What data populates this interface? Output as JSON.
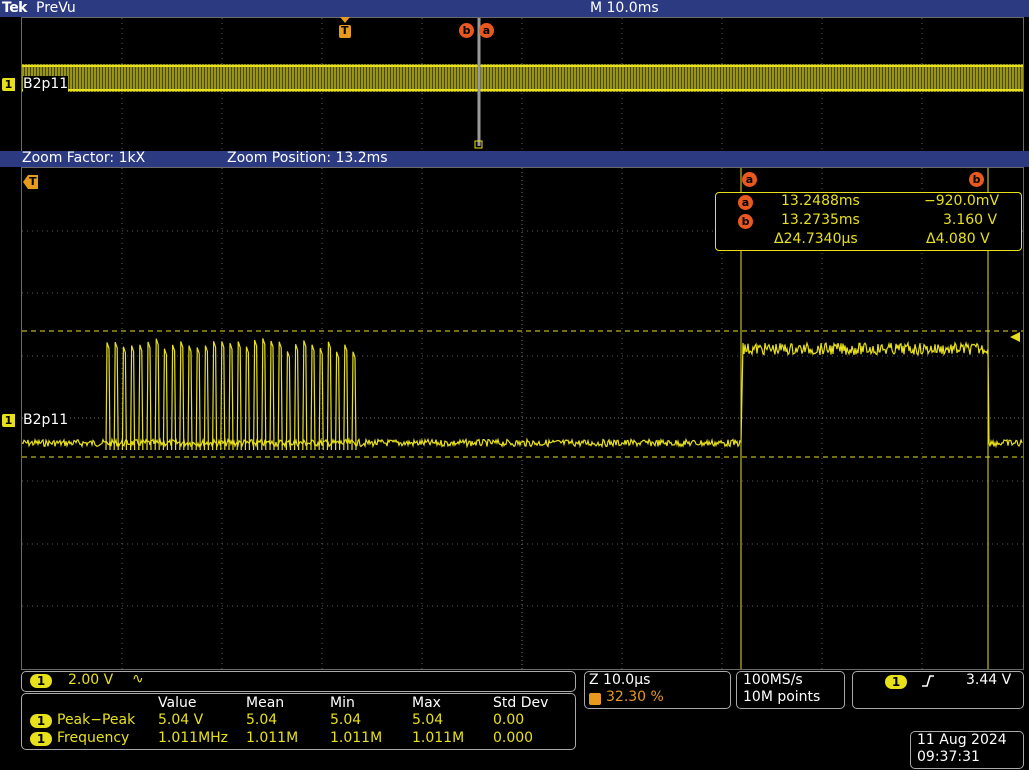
{
  "header": {
    "brand": "Tek",
    "mode": "PreVu",
    "timebase": "M 10.0ms"
  },
  "zoom": {
    "factor": "Zoom Factor: 1kX",
    "position": "Zoom Position: 13.2ms"
  },
  "channel": {
    "number": "1",
    "label": "B2p11"
  },
  "markers": {
    "trigger": "T",
    "a": "a",
    "b": "b"
  },
  "cursors": {
    "a_time": "13.2488ms",
    "a_value": "−920.0mV",
    "b_time": "13.2735ms",
    "b_value": "3.160 V",
    "delta_time": "Δ24.7340µs",
    "delta_value": "Δ4.080 V"
  },
  "vertical": {
    "scale": "2.00 V",
    "coupling_icon": "∿"
  },
  "horizontal_zoom": {
    "scale": "Z 10.0µs",
    "trigger_pos": "32.30 %"
  },
  "acquisition": {
    "rate": "100MS/s",
    "points": "10M points"
  },
  "trigger": {
    "slope_icon": "rising-edge-icon",
    "level": "3.44 V"
  },
  "measurements": {
    "headers": [
      "Value",
      "Mean",
      "Min",
      "Max",
      "Std Dev"
    ],
    "rows": [
      {
        "name": "Peak−Peak",
        "value": "5.04 V",
        "mean": "5.04",
        "min": "5.04",
        "max": "5.04",
        "std": "0.00"
      },
      {
        "name": "Frequency",
        "value": "1.011MHz",
        "mean": "1.011M",
        "min": "1.011M",
        "max": "1.011M",
        "std": "0.000"
      }
    ]
  },
  "datetime": {
    "date": "11 Aug 2024",
    "time": "09:37:31"
  },
  "colors": {
    "trace": "#e7e01a",
    "bar": "#2c3a82",
    "marker": "#e8581f"
  }
}
